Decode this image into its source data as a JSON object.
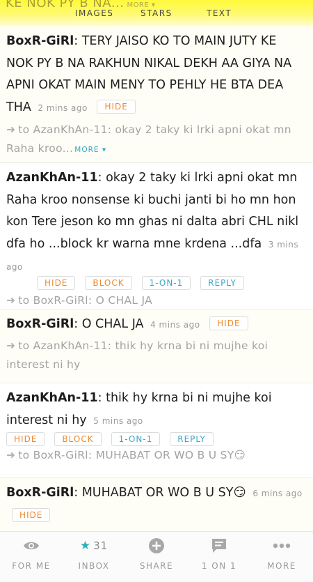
{
  "header": {
    "ghost_text": "KE NOK PY B NA...",
    "ghost_more": "MORE ▾",
    "tabs": [
      "IMAGES",
      "STARS",
      "TEXT"
    ]
  },
  "posts": [
    {
      "user": "BoxR-GiRl",
      "text": ": TERY JAISO KO TO MAIN JUTY KE NOK PY B NA RAKHUN NIKAL DEKH AA GIYA NA APNI OKAT MAIN MENY TO PEHLY HE BTA DEA THA",
      "time": "2 mins ago",
      "buttons": [
        "HIDE"
      ],
      "reply": "to AzanKhAn-11: okay 2 taky ki lrki apni okat mn Raha kroo...",
      "reply_more": "MORE ▾"
    },
    {
      "user": "AzanKhAn-11",
      "text": ": okay 2 taky ki lrki apni okat mn Raha kroo nonsense ki buchi janti bi ho mn hon kon Tere jeson ko mn ghas ni dalta abri CHL nikl dfa ho ...block kr warna mne krdena ...dfa",
      "time": "3 mins ago",
      "buttons": [
        "HIDE",
        "BLOCK",
        "1-ON-1",
        "REPLY"
      ],
      "reply": "to BoxR-GiRl: O CHAL JA"
    },
    {
      "user": "BoxR-GiRl",
      "text": ": O CHAL JA",
      "time": "4 mins ago",
      "buttons": [
        "HIDE"
      ],
      "reply": "to AzanKhAn-11: thik hy krna bi ni mujhe koi interest ni hy"
    },
    {
      "user": "AzanKhAn-11",
      "text": ": thik hy krna bi ni mujhe koi interest ni hy",
      "time": "5 mins ago",
      "buttons": [
        "HIDE",
        "BLOCK",
        "1-ON-1",
        "REPLY"
      ],
      "reply": "to BoxR-GiRl: MUHABAT OR WO B U SY😏"
    },
    {
      "user": "BoxR-GiRl",
      "text": ": MUHABAT OR WO B U SY😏",
      "time": "6 mins ago",
      "buttons": [
        "HIDE"
      ]
    }
  ],
  "bottom_nav": {
    "for_me": "FOR ME",
    "inbox": "INBOX",
    "inbox_count": "31",
    "share": "SHARE",
    "one_on_one": "1 ON 1",
    "more": "MORE"
  },
  "colors": {
    "header_yellow": "#fff93a",
    "button_orange": "#f08a2c",
    "button_blue": "#3aa7c9",
    "star_teal": "#2bb3b8"
  },
  "icons": [
    "eye-icon",
    "star-icon",
    "plus-circle-icon",
    "chat-bubble-icon",
    "dots-icon",
    "arrow-right-icon"
  ]
}
